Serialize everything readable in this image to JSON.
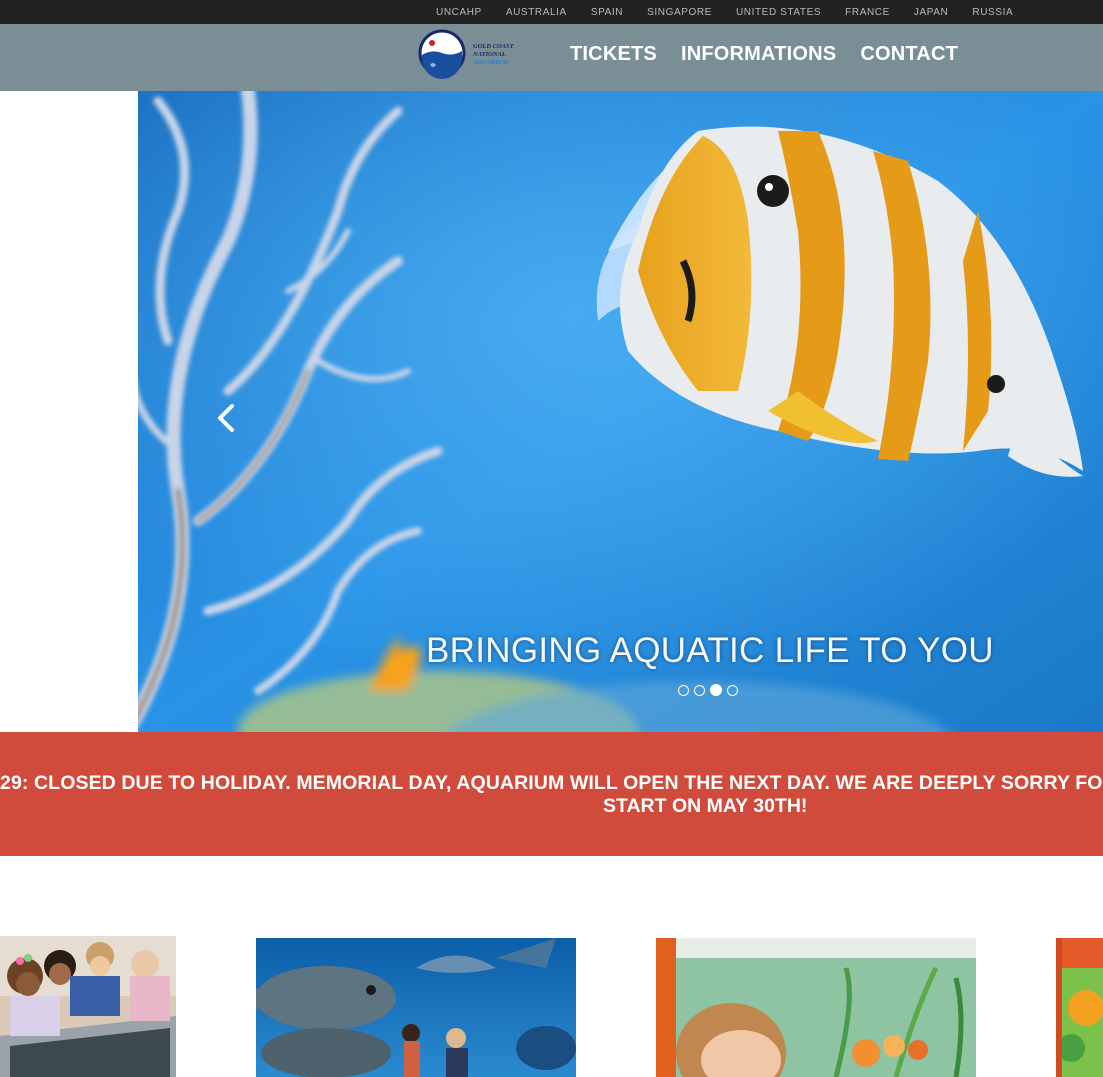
{
  "topbar": {
    "countries": [
      "UNCAHP",
      "AUSTRALIA",
      "SPAIN",
      "SINGAPORE",
      "UNITED STATES",
      "FRANCE",
      "JAPAN",
      "RUSSIA"
    ]
  },
  "logo": {
    "line1": "GOLD COAST",
    "line2": "NATIONAL",
    "line3": "AQUARIUM"
  },
  "nav": {
    "items": [
      "TICKETS",
      "INFORMATIONS",
      "CONTACT"
    ]
  },
  "carousel": {
    "caption": "BRINGING AQUATIC LIFE TO YOU",
    "slide_count": 4,
    "active_index": 2
  },
  "notice": {
    "line1": "29: CLOSED DUE TO HOLIDAY. MEMORIAL DAY, AQUARIUM WILL OPEN THE NEXT DAY. WE ARE DEEPLY SORRY FO",
    "line2": "START ON MAY 30TH!"
  },
  "colors": {
    "topbar": "#222222",
    "header": "#7a8e96",
    "notice": "#d04b3b",
    "ocean": "#1f86d8"
  }
}
